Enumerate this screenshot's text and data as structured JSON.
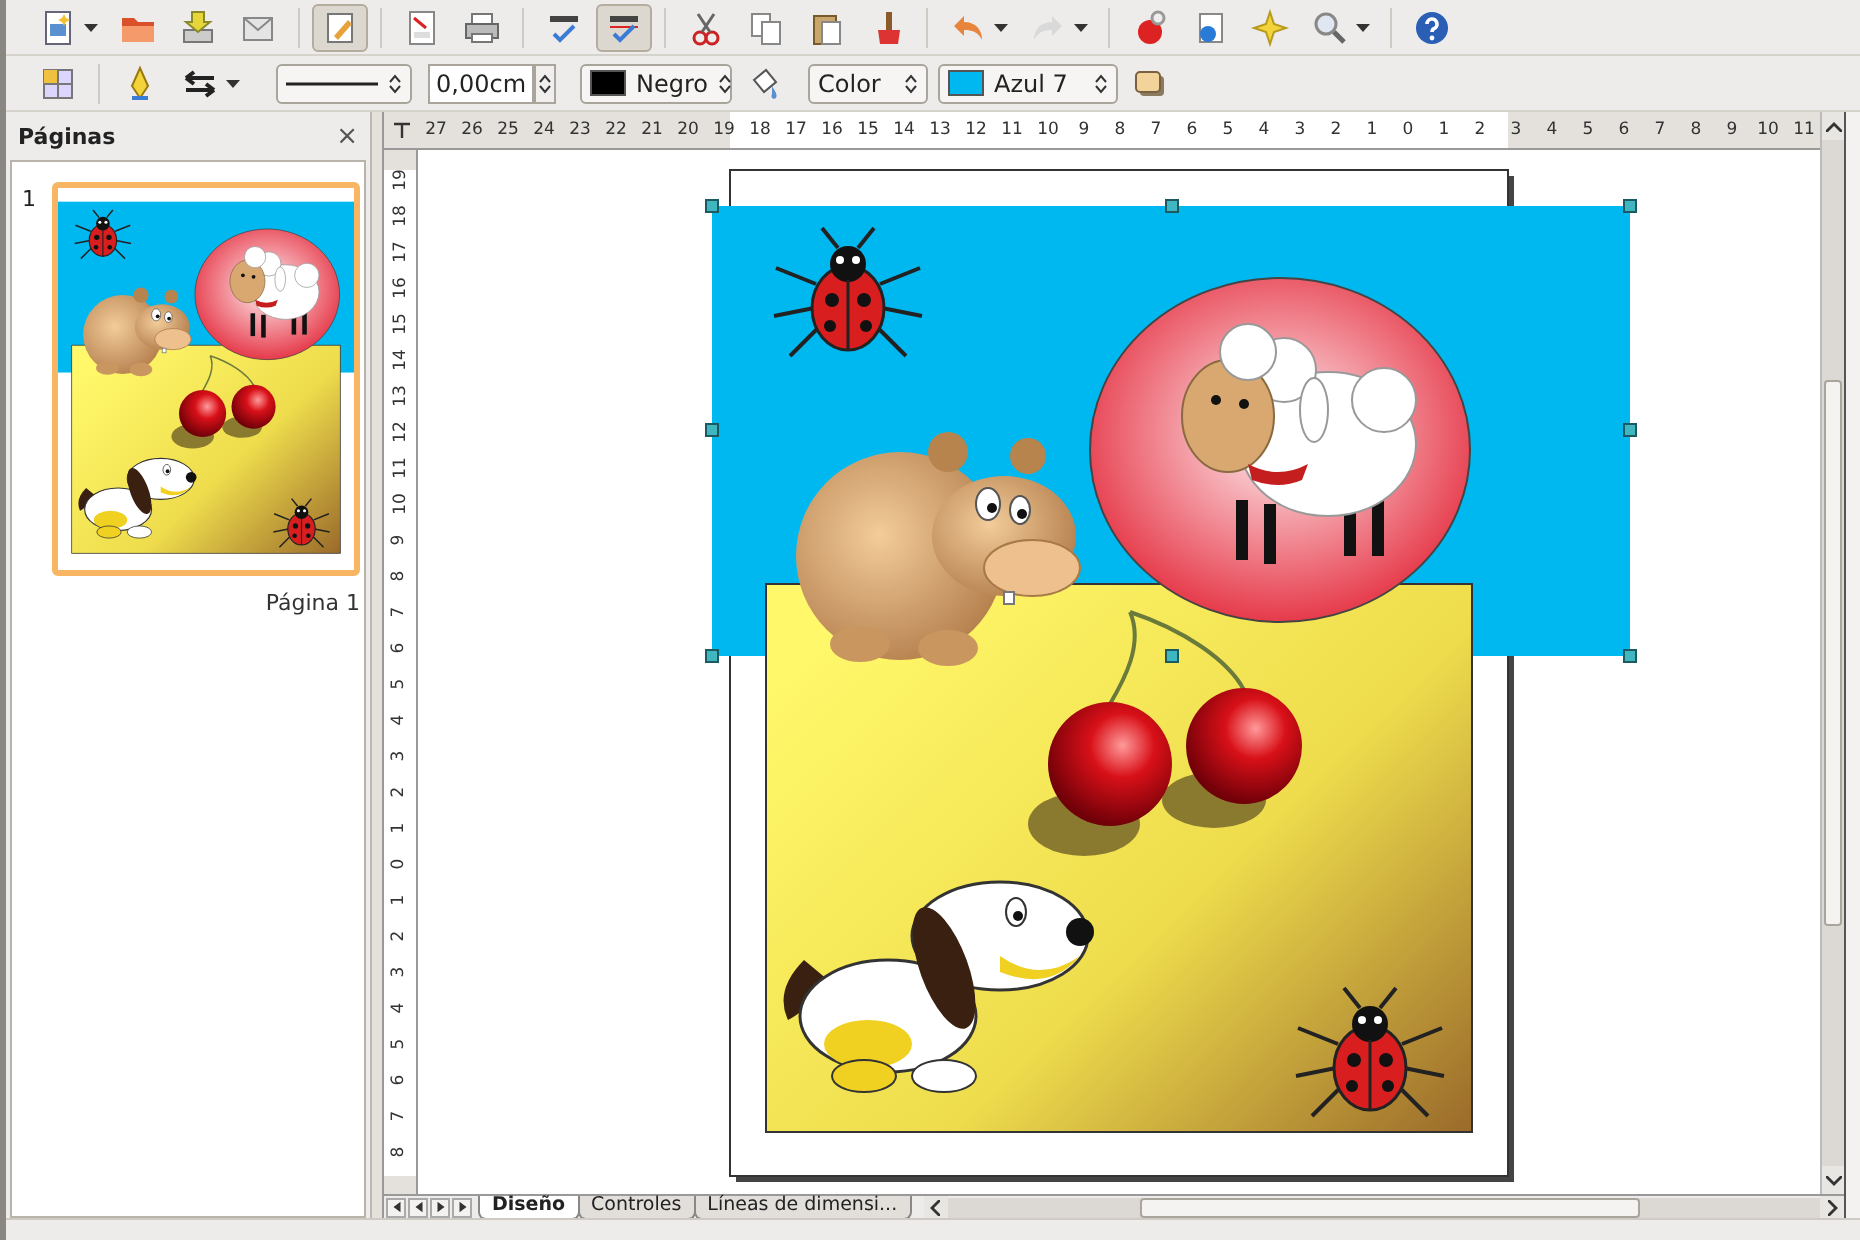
{
  "toolbar_standard": {
    "groups": [
      [
        {
          "pressed": false,
          "disabled": false,
          "dropdown": true
        },
        {
          "pressed": false,
          "disabled": false,
          "dropdown": false
        },
        {
          "pressed": false,
          "disabled": false,
          "dropdown": false
        },
        {
          "pressed": false,
          "disabled": false,
          "dropdown": false
        }
      ],
      [
        {
          "pressed": true,
          "disabled": false,
          "dropdown": false
        }
      ],
      [
        {
          "pressed": false,
          "disabled": false,
          "dropdown": false
        },
        {
          "pressed": false,
          "disabled": false,
          "dropdown": false
        }
      ],
      [
        {
          "pressed": false,
          "disabled": false,
          "dropdown": false
        },
        {
          "pressed": true,
          "disabled": false,
          "dropdown": false
        }
      ],
      [
        {
          "pressed": false,
          "disabled": false,
          "dropdown": false
        },
        {
          "pressed": false,
          "disabled": false,
          "dropdown": false
        },
        {
          "pressed": false,
          "disabled": false,
          "dropdown": false
        },
        {
          "pressed": false,
          "disabled": false,
          "dropdown": false
        }
      ],
      [
        {
          "pressed": false,
          "disabled": false,
          "dropdown": true
        },
        {
          "pressed": false,
          "disabled": true,
          "dropdown": true
        }
      ],
      [
        {
          "pressed": false,
          "disabled": false,
          "dropdown": false
        },
        {
          "pressed": false,
          "disabled": false,
          "dropdown": false
        },
        {
          "pressed": false,
          "disabled": false,
          "dropdown": false
        },
        {
          "pressed": false,
          "disabled": false,
          "dropdown": true
        }
      ],
      [
        {
          "pressed": false,
          "disabled": false,
          "dropdown": false
        }
      ]
    ]
  },
  "toolbar_line_fill": {
    "line_width": "0,00cm",
    "line_color": {
      "label": "Negro",
      "color": "#000000"
    },
    "area_style": "Color",
    "area_fill": {
      "label": "Azul 7",
      "color": "#00b8f0"
    }
  },
  "pages_panel": {
    "title": "Páginas",
    "close": "×",
    "pages": [
      {
        "number": "1",
        "label": "Página 1",
        "selected": true
      }
    ]
  },
  "ruler_horizontal": {
    "labels": [
      "27",
      "26",
      "25",
      "24",
      "23",
      "22",
      "21",
      "20",
      "19",
      "18",
      "17",
      "16",
      "15",
      "14",
      "13",
      "12",
      "11",
      "10",
      "9",
      "8",
      "7",
      "6",
      "5",
      "4",
      "3",
      "2",
      "1",
      "0",
      "1",
      "2",
      "3",
      "4",
      "5",
      "6",
      "7",
      "8",
      "9",
      "10",
      "11"
    ]
  },
  "ruler_vertical": {
    "labels": [
      "19",
      "18",
      "17",
      "16",
      "15",
      "14",
      "13",
      "12",
      "11",
      "10",
      "9",
      "8",
      "7",
      "6",
      "5",
      "4",
      "3",
      "2",
      "1",
      "0",
      "1",
      "2",
      "3",
      "4",
      "5",
      "6",
      "7",
      "8"
    ]
  },
  "layer_tabs": [
    {
      "label": "Diseño",
      "selected": true
    },
    {
      "label": "Controles",
      "selected": false
    },
    {
      "label": "Líneas de dimensi...",
      "selected": false
    }
  ]
}
